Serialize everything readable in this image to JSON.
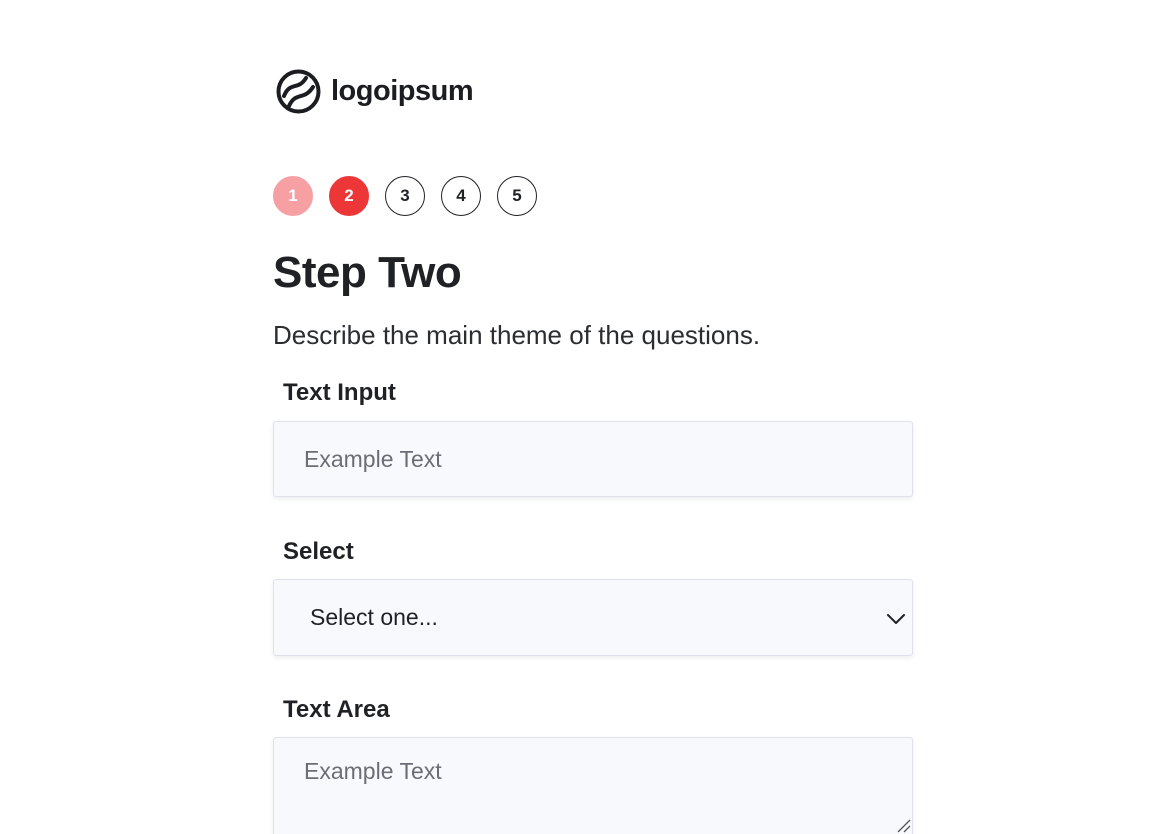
{
  "brand": {
    "logo_text": "logoipsum",
    "logo_icon": "logoipsum-mark-icon"
  },
  "stepper": {
    "steps": [
      "1",
      "2",
      "3",
      "4",
      "5"
    ],
    "completed": [
      "1"
    ],
    "current": "2",
    "colors": {
      "completed": "#f6a0a3",
      "current": "#ec3638",
      "pending_border": "#1f2125"
    }
  },
  "page": {
    "title": "Step Two",
    "subtitle": "Describe the main theme of the questions."
  },
  "form": {
    "text_input": {
      "label": "Text Input",
      "placeholder": "Example Text",
      "value": ""
    },
    "select": {
      "label": "Select",
      "selected": "Select one...",
      "icon": "chevron-down-icon"
    },
    "text_area": {
      "label": "Text Area",
      "placeholder": "Example Text",
      "value": ""
    }
  }
}
